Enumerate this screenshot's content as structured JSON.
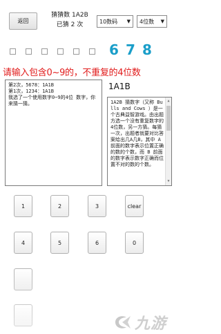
{
  "toolbar": {
    "back_label": "返回",
    "status_line1": "猜猜数 1A2B",
    "status_line2": "已猜 2 次",
    "select_mode": "10数码",
    "select_digits": "4位数"
  },
  "answer_digits": [
    "6",
    "7",
    "8"
  ],
  "prompt_text": "请输入包含0~9的，不重复的4位数",
  "result_label": "1A1B",
  "history_text": "第2次，5678：1A1B\n第1次，1234：1A1B\n我选了一个使用数字0~9的4位 数字，你来猜一猜。",
  "rules_text": "1A2B 猜数字（又称 Bulls and Cows ）是一个古典益智游戏。由出题方选一个没有重复数字的4位数，另一方猜。每猜一次，出题者就要对比答案给出几A几B，其中 A 前面的数字表示位置正确的数的个数，而 B 前面的数字表示数字正确而位置不对的数的个数。",
  "keypad": {
    "row1": [
      "1",
      "2",
      "3",
      "clear"
    ],
    "row2": [
      "4",
      "5",
      "6",
      "0"
    ]
  },
  "watermark": {
    "text": "九游"
  }
}
